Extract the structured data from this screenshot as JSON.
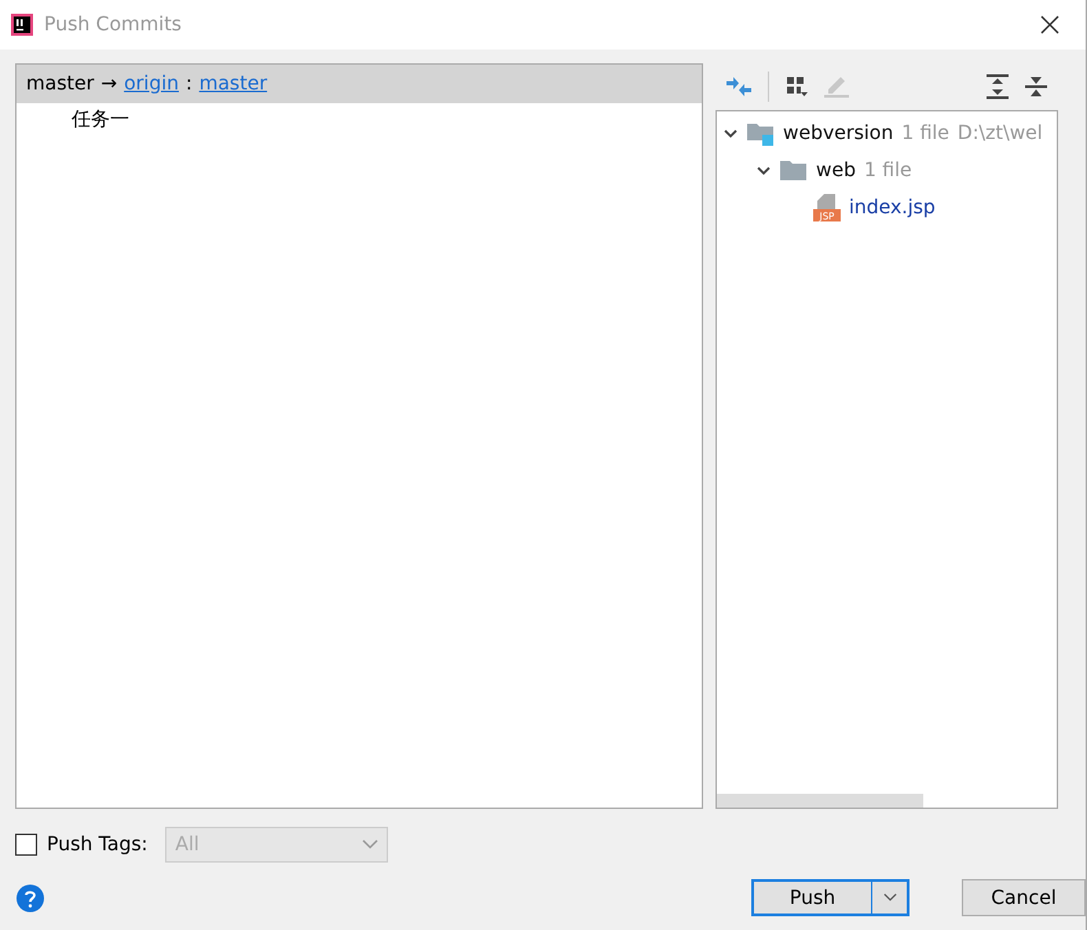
{
  "window": {
    "title": "Push Commits"
  },
  "commits": {
    "branch": {
      "local": "master",
      "arrow": "→",
      "remote": "origin",
      "separator": ":",
      "remote_branch": "master",
      "selected": true
    },
    "items": [
      {
        "message": "任务一",
        "selected": false
      }
    ]
  },
  "toolbar": {
    "left": [
      {
        "disabled": false
      },
      {
        "disabled": false
      },
      {
        "disabled": true
      }
    ],
    "right": [
      {
        "disabled": false
      },
      {
        "disabled": false
      }
    ]
  },
  "tree": [
    {
      "kind": "module",
      "name": "webversion",
      "count": "1 file",
      "path": "D:\\zt\\wel",
      "expanded": true,
      "children": [
        {
          "kind": "folder",
          "name": "web",
          "count": "1 file",
          "expanded": true,
          "children": [
            {
              "kind": "file",
              "name": "index.jsp",
              "badge": "JSP"
            }
          ]
        }
      ]
    }
  ],
  "push_tags": {
    "label": "Push Tags:",
    "checked": false,
    "combo": {
      "value": "All",
      "disabled": true
    }
  },
  "buttons": [
    {
      "label": "Push",
      "kind": "primary"
    },
    {
      "label": "Cancel",
      "kind": "normal"
    }
  ]
}
